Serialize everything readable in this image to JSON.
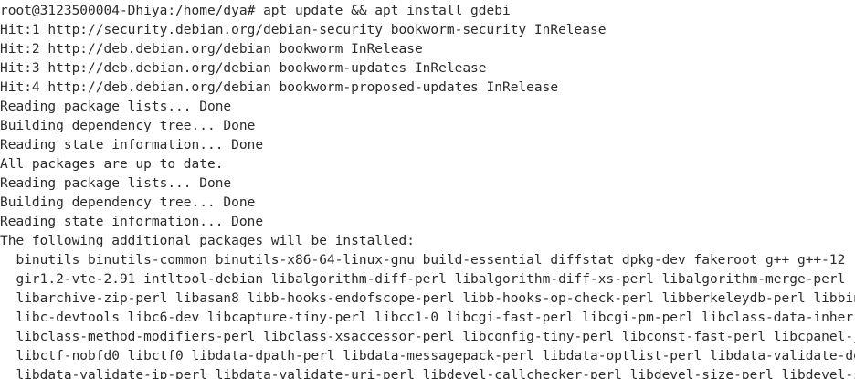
{
  "terminal": {
    "lines": [
      "root@3123500004-Dhiya:/home/dya# apt update && apt install gdebi",
      "Hit:1 http://security.debian.org/debian-security bookworm-security InRelease",
      "Hit:2 http://deb.debian.org/debian bookworm InRelease",
      "Hit:3 http://deb.debian.org/debian bookworm-updates InRelease",
      "Hit:4 http://deb.debian.org/debian bookworm-proposed-updates InRelease",
      "Reading package lists... Done",
      "Building dependency tree... Done",
      "Reading state information... Done",
      "All packages are up to date.",
      "Reading package lists... Done",
      "Building dependency tree... Done",
      "Reading state information... Done",
      "The following additional packages will be installed:",
      "  binutils binutils-common binutils-x86-64-linux-gnu build-essential diffstat dpkg-dev fakeroot g++ g++-12",
      "  gir1.2-vte-2.91 intltool-debian libalgorithm-diff-perl libalgorithm-diff-xs-perl libalgorithm-merge-perl",
      "  libarchive-zip-perl libasan8 libb-hooks-endofscope-perl libb-hooks-op-check-perl libberkeleydb-perl libbinutils",
      "  libc-devtools libc6-dev libcapture-tiny-perl libcc1-0 libcgi-fast-perl libcgi-pm-perl libclass-data-inheritable-perl",
      "  libclass-method-modifiers-perl libclass-xsaccessor-perl libconfig-tiny-perl libconst-fast-perl libcpanel-json-xs-perl",
      "  libctf-nobfd0 libctf0 libdata-dpath-perl libdata-messagepack-perl libdata-optlist-perl libdata-validate-domain-perl",
      "  libdata-validate-ip-perl libdata-validate-uri-perl libdevel-callchecker-perl libdevel-size-perl libdevel-stacktrace-perl"
    ]
  }
}
